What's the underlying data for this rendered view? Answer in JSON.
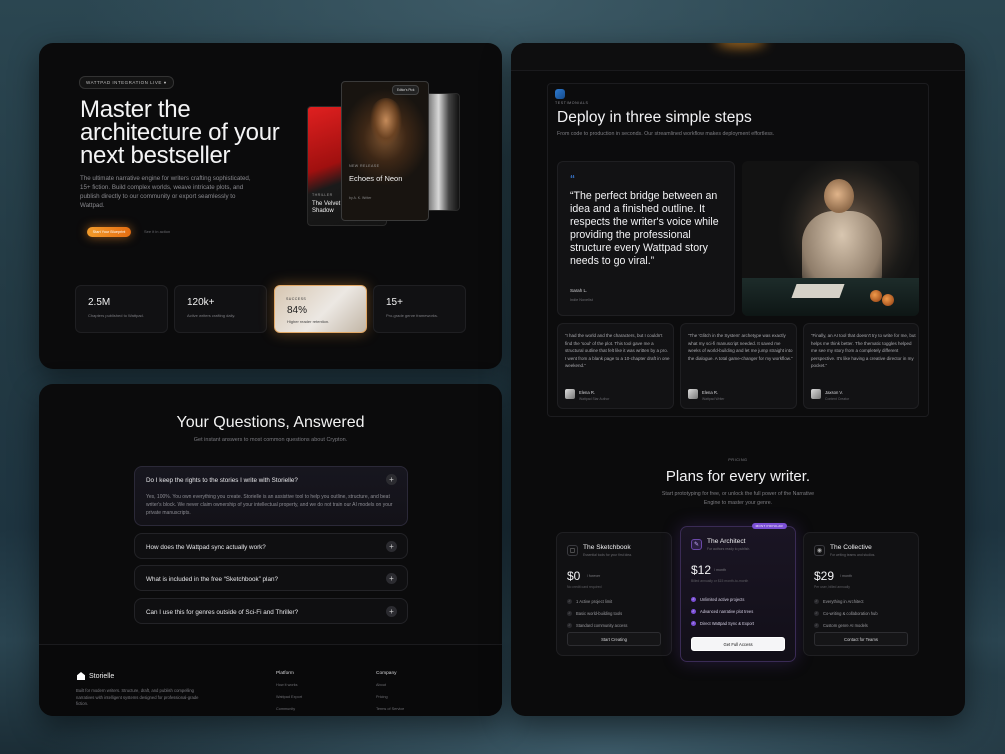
{
  "hero": {
    "badge": "WATTPAD INTEGRATION LIVE  ●",
    "title": "Master the architecture of your next bestseller",
    "description": "The ultimate narrative engine for writers crafting sophisticated, 15+ fiction. Build complex worlds, weave intricate plots, and publish directly to our community or export seamlessly to Wattpad.",
    "cta_primary": "Start Your Blueprint",
    "cta_secondary": "See it in action",
    "books": {
      "main_tag": "NEW RELEASE",
      "main_title": "Echoes of Neon",
      "main_author": "by A. K. Writer",
      "main_chip": "Editor's Pick",
      "left_tag": "THRILLER",
      "left_title": "The Velvet Shadow"
    },
    "stats": [
      {
        "value": "2.5M",
        "label": "Chapters published to Wattpad."
      },
      {
        "value": "120k+",
        "label": "Active writers crafting daily."
      },
      {
        "small": "SUCCESS",
        "value": "84%",
        "label": "Higher reader retention."
      },
      {
        "value": "15+",
        "label": "Pro-grade genre frameworks."
      }
    ]
  },
  "faq": {
    "title": "Your Questions, Answered",
    "subtitle": "Get instant answers to most common questions about Crypton.",
    "items": [
      {
        "q": "Do I keep the rights to the stories I write with Storielle?",
        "a": "Yes, 100%. You own everything you create. Storielle is an assistive tool to help you outline, structure, and beat writer's block. We never claim ownership of your intellectual property, and we do not train our AI models on your private manuscripts."
      },
      {
        "q": "How does the Wattpad sync actually work?"
      },
      {
        "q": "What is included in the free “Sketchbook” plan?"
      },
      {
        "q": "Can I use this for genres outside of Sci-Fi and Thriller?"
      }
    ]
  },
  "footer": {
    "brand": "Storielle",
    "description": "Built for modern writers. Structure, draft, and publish compelling narratives with intelligent systems designed for professional-grade fiction.",
    "columns": [
      {
        "heading": "Platform",
        "links": [
          "How it works",
          "Wattpad Export",
          "Community"
        ]
      },
      {
        "heading": "Company",
        "links": [
          "About",
          "Pricing",
          "Terms of Service"
        ]
      }
    ]
  },
  "deploy": {
    "kicker": "TESTIMONIALS",
    "title": "Deploy in three simple steps",
    "subtitle": "From code to production in seconds. Our streamlined workflow makes deployment effortless.",
    "quote_mark": "“",
    "quote": "“The perfect bridge between an idea and a finished outline. It respects the writer's voice while providing the professional structure every Wattpad story needs to go viral.”",
    "quote_name": "Sarah L.",
    "quote_role": "Indie Novelist",
    "testimonials": [
      {
        "text": "“I had the world and the characters, but I couldn't find the 'soul' of the plot. This tool gave me a structural outline that felt like it was written by a pro. I went from a blank page to a 10-chapter draft in one weekend.”",
        "name": "Elena R.",
        "role": "Wattpad Star Author"
      },
      {
        "text": "“The 'Glitch in the System' archetype was exactly what my sci-fi manuscript needed. It saved me weeks of world-building and let me jump straight into the dialogue. A total game-changer for my workflow.”",
        "name": "Elena R.",
        "role": "Wattpad Writer"
      },
      {
        "text": "“Finally, an AI tool that doesn't try to write for me, but helps me think better. The thematic toggles helped me see my story from a completely different perspective. It's like having a creative director in my pocket.”",
        "name": "Jaxson V.",
        "role": "Content Creator"
      }
    ]
  },
  "pricing": {
    "kicker": "PRICING",
    "title": "Plans for every writer.",
    "subtitle": "Start prototyping for free, or unlock the full power of the Narrative Engine to master your genre.",
    "plans": [
      {
        "name": "The Sketchbook",
        "desc": "Essential tools for your first idea.",
        "price": "$0",
        "per": "/ forever",
        "note": "No credit card required",
        "features": [
          "1 Active project limit",
          "Basic world-building tools",
          "Standard community access"
        ],
        "button": "Start Creating"
      },
      {
        "name": "The Architect",
        "desc": "For authors ready to publish.",
        "price": "$12",
        "per": "/ month",
        "note": "Billed annually or $15 month-to-month",
        "features": [
          "Unlimited active projects",
          "Advanced narrative plot trees",
          "Direct Wattpad Sync & Export"
        ],
        "button": "Get Full Access",
        "badge": "MOST POPULAR"
      },
      {
        "name": "The Collective",
        "desc": "For writing teams and studios.",
        "price": "$29",
        "per": "/ month",
        "note": "Per user, billed annually",
        "features": [
          "Everything in Architect",
          "Co-writing & collaboration hub",
          "Custom genre AI models"
        ],
        "button": "Contact for Teams"
      }
    ]
  }
}
